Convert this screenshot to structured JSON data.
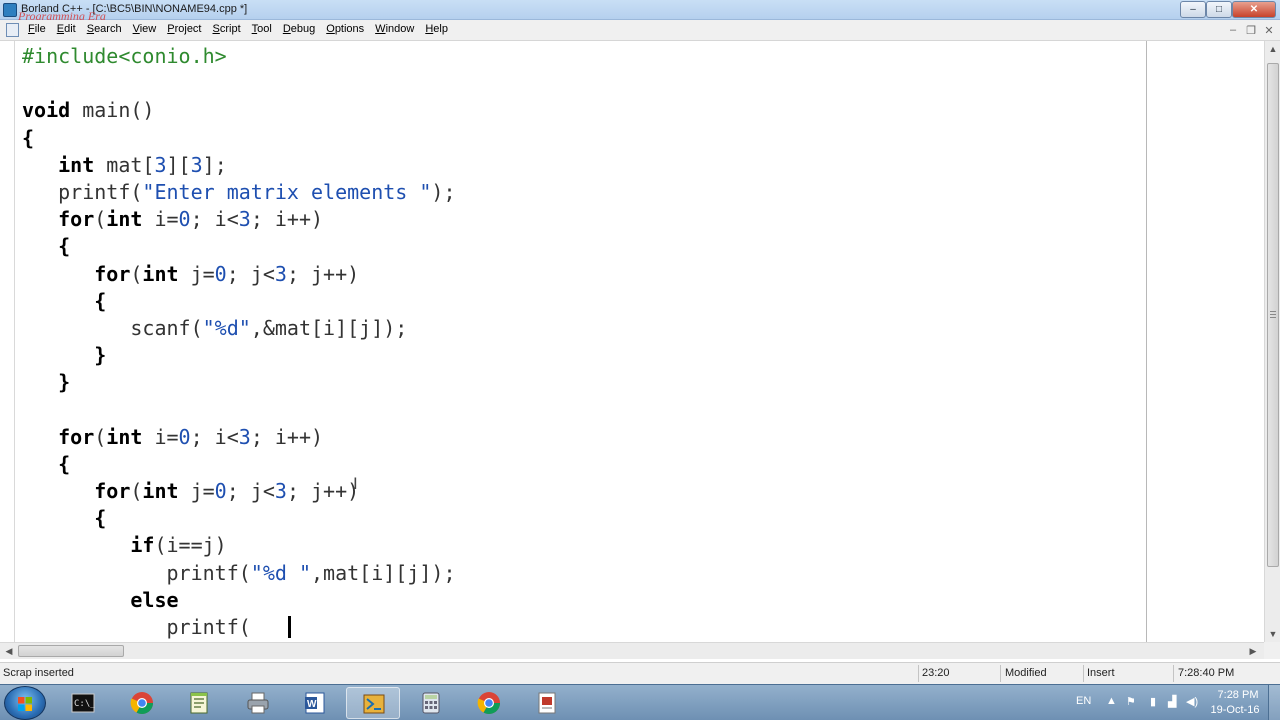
{
  "window": {
    "title": "Borland C++ - [C:\\BC5\\BIN\\NONAME94.cpp *]",
    "watermark": "Programming Era",
    "minimize": "–",
    "maximize": "□",
    "close": "✕"
  },
  "menu": {
    "items": [
      {
        "acc": "F",
        "rest": "ile"
      },
      {
        "acc": "E",
        "rest": "dit"
      },
      {
        "acc": "S",
        "rest": "earch"
      },
      {
        "acc": "V",
        "rest": "iew"
      },
      {
        "acc": "P",
        "rest": "roject"
      },
      {
        "acc": "S",
        "rest": "cript"
      },
      {
        "acc": "T",
        "rest": "ool"
      },
      {
        "acc": "D",
        "rest": "ebug"
      },
      {
        "acc": "O",
        "rest": "ptions"
      },
      {
        "acc": "W",
        "rest": "indow"
      },
      {
        "acc": "H",
        "rest": "elp"
      }
    ],
    "doc_min": "–",
    "doc_restore": "❐",
    "doc_close": "✕"
  },
  "editor": {
    "lines": [
      [
        {
          "t": "#include<conio.h>",
          "c": "pp"
        }
      ],
      [],
      [
        {
          "t": "void",
          "c": "kw"
        },
        {
          "t": " main()",
          "c": "ident"
        }
      ],
      [
        {
          "t": "{",
          "c": "kw"
        }
      ],
      [
        {
          "t": "   "
        },
        {
          "t": "int",
          "c": "kw"
        },
        {
          "t": " mat[",
          "c": "ident"
        },
        {
          "t": "3",
          "c": "num"
        },
        {
          "t": "][",
          "c": "ident"
        },
        {
          "t": "3",
          "c": "num"
        },
        {
          "t": "];",
          "c": "ident"
        }
      ],
      [
        {
          "t": "   printf(",
          "c": "ident"
        },
        {
          "t": "\"Enter matrix elements \"",
          "c": "str"
        },
        {
          "t": ");",
          "c": "ident"
        }
      ],
      [
        {
          "t": "   "
        },
        {
          "t": "for",
          "c": "kw"
        },
        {
          "t": "(",
          "c": "ident"
        },
        {
          "t": "int",
          "c": "kw"
        },
        {
          "t": " i=",
          "c": "ident"
        },
        {
          "t": "0",
          "c": "num"
        },
        {
          "t": "; i<",
          "c": "ident"
        },
        {
          "t": "3",
          "c": "num"
        },
        {
          "t": "; i++)",
          "c": "ident"
        }
      ],
      [
        {
          "t": "   "
        },
        {
          "t": "{",
          "c": "kw"
        }
      ],
      [
        {
          "t": "      "
        },
        {
          "t": "for",
          "c": "kw"
        },
        {
          "t": "(",
          "c": "ident"
        },
        {
          "t": "int",
          "c": "kw"
        },
        {
          "t": " j=",
          "c": "ident"
        },
        {
          "t": "0",
          "c": "num"
        },
        {
          "t": "; j<",
          "c": "ident"
        },
        {
          "t": "3",
          "c": "num"
        },
        {
          "t": "; j++)",
          "c": "ident"
        }
      ],
      [
        {
          "t": "      "
        },
        {
          "t": "{",
          "c": "kw"
        }
      ],
      [
        {
          "t": "         scanf(",
          "c": "ident"
        },
        {
          "t": "\"%d\"",
          "c": "str"
        },
        {
          "t": ",&mat[i][j]);",
          "c": "ident"
        }
      ],
      [
        {
          "t": "      "
        },
        {
          "t": "}",
          "c": "kw"
        }
      ],
      [
        {
          "t": "   "
        },
        {
          "t": "}",
          "c": "kw"
        }
      ],
      [],
      [
        {
          "t": "   "
        },
        {
          "t": "for",
          "c": "kw"
        },
        {
          "t": "(",
          "c": "ident"
        },
        {
          "t": "int",
          "c": "kw"
        },
        {
          "t": " i=",
          "c": "ident"
        },
        {
          "t": "0",
          "c": "num"
        },
        {
          "t": "; i<",
          "c": "ident"
        },
        {
          "t": "3",
          "c": "num"
        },
        {
          "t": "; i++)",
          "c": "ident"
        }
      ],
      [
        {
          "t": "   "
        },
        {
          "t": "{",
          "c": "kw"
        }
      ],
      [
        {
          "t": "      "
        },
        {
          "t": "for",
          "c": "kw"
        },
        {
          "t": "(",
          "c": "ident"
        },
        {
          "t": "int",
          "c": "kw"
        },
        {
          "t": " j=",
          "c": "ident"
        },
        {
          "t": "0",
          "c": "num"
        },
        {
          "t": "; j<",
          "c": "ident"
        },
        {
          "t": "3",
          "c": "num"
        },
        {
          "t": "; j++)",
          "c": "ident"
        }
      ],
      [
        {
          "t": "      "
        },
        {
          "t": "{",
          "c": "kw"
        }
      ],
      [
        {
          "t": "         "
        },
        {
          "t": "if",
          "c": "kw"
        },
        {
          "t": "(i==j)",
          "c": "ident"
        }
      ],
      [
        {
          "t": "            printf(",
          "c": "ident"
        },
        {
          "t": "\"%d \"",
          "c": "str"
        },
        {
          "t": ",mat[i][j]);",
          "c": "ident"
        }
      ],
      [
        {
          "t": "         "
        },
        {
          "t": "else",
          "c": "kw"
        }
      ],
      [
        {
          "t": "            printf(",
          "c": "ident"
        }
      ]
    ]
  },
  "statusbar": {
    "message": "Scrap inserted",
    "position": "23:20",
    "modified": "Modified",
    "mode": "Insert",
    "time": "7:28:40 PM"
  },
  "taskbar": {
    "apps": [
      "cmd-icon",
      "chrome-icon",
      "notepad-icon",
      "printer-icon",
      "word-icon",
      "borland-icon",
      "calculator-icon",
      "chrome-icon",
      "document-icon"
    ],
    "language": "EN",
    "clock_time": "7:28 PM",
    "clock_date": "19-Oct-16"
  }
}
